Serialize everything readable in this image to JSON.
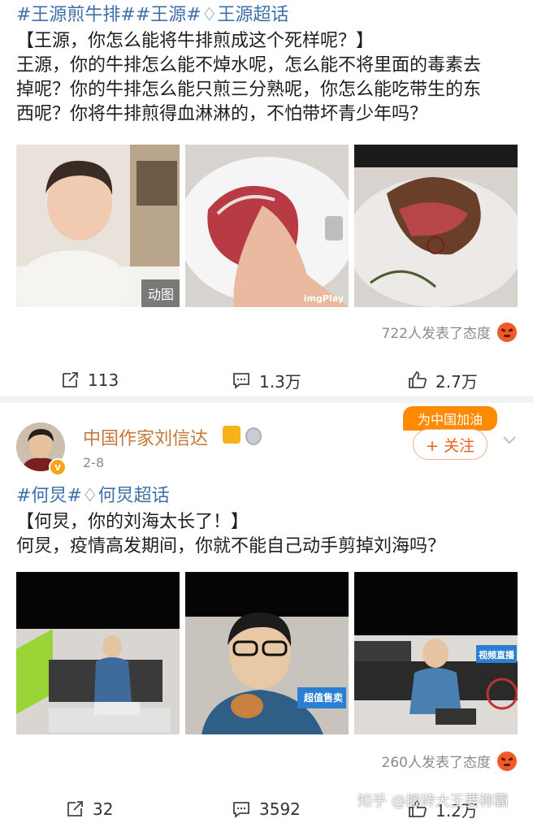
{
  "post1": {
    "tags": [
      "#王源煎牛排#",
      "#王源#",
      "王源超话"
    ],
    "title_line": "【王源，你怎么能将牛排煎成这个死样呢？】",
    "body_lines": [
      "王源，你的牛排怎么能不焯水呢，怎么能不将里面的毒素去",
      "掉呢？你的牛排怎么能只煎三分熟呢，你怎么能吃带生的东",
      "西呢？你将牛排煎得血淋淋的，不怕带坏青少年吗？"
    ],
    "gif_label": "动图",
    "watermark": "imgPlay",
    "reactions_text": "722人发表了态度",
    "repost_count": "113",
    "comment_count": "1.3万",
    "like_count": "2.7万"
  },
  "post2": {
    "author": "中国作家刘信达",
    "date": "2-8",
    "campaign_badge": "为中国加油",
    "follow_label": "+ 关注",
    "tags": [
      "#何炅#",
      "何炅超话"
    ],
    "title_line": "【何炅，你的刘海太长了！】",
    "body_lines": [
      "何炅，疫情高发期间，你就不能自己动手剪掉刘海吗？"
    ],
    "img2_caption": "超值售卖",
    "img3_caption": "视频直播",
    "reactions_text": "260人发表了态度",
    "repost_count": "32",
    "comment_count": "3592",
    "like_count": "1.2万"
  },
  "watermark_overlay": "知乎 @搬砖大王要称霸"
}
